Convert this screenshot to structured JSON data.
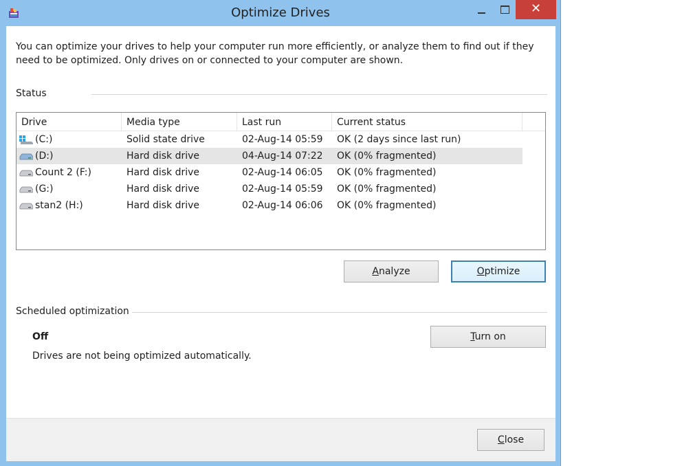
{
  "window": {
    "title": "Optimize Drives",
    "close_glyph": "✕"
  },
  "description": "You can optimize your drives to help your computer run more efficiently, or analyze them to find out if they need to be optimized. Only drives on or connected to your computer are shown.",
  "status_section": {
    "label": "Status",
    "columns": [
      "Drive",
      "Media type",
      "Last run",
      "Current status"
    ],
    "rows": [
      {
        "drive": "(C:)",
        "media": "Solid state drive",
        "last_run": "02-Aug-14 05:59",
        "status": "OK (2 days since last run)",
        "icon": "windows-drive-icon"
      },
      {
        "drive": "(D:)",
        "media": "Hard disk drive",
        "last_run": "04-Aug-14 07:22",
        "status": "OK (0% fragmented)",
        "icon": "hard-drive-icon",
        "selected": true
      },
      {
        "drive": "Count 2 (F:)",
        "media": "Hard disk drive",
        "last_run": "02-Aug-14 06:05",
        "status": "OK (0% fragmented)",
        "icon": "hard-drive-icon"
      },
      {
        "drive": "(G:)",
        "media": "Hard disk drive",
        "last_run": "02-Aug-14 05:59",
        "status": "OK (0% fragmented)",
        "icon": "hard-drive-icon"
      },
      {
        "drive": "stan2 (H:)",
        "media": "Hard disk drive",
        "last_run": "02-Aug-14 06:06",
        "status": "OK (0% fragmented)",
        "icon": "hard-drive-icon"
      }
    ],
    "analyze_button": {
      "pre": "",
      "accel": "A",
      "post": "nalyze"
    },
    "optimize_button": {
      "pre": "",
      "accel": "O",
      "post": "ptimize"
    }
  },
  "scheduled_section": {
    "label": "Scheduled optimization",
    "state": "Off",
    "description": "Drives are not being optimized automatically.",
    "turn_on_button": {
      "pre": "",
      "accel": "T",
      "post": "urn on"
    }
  },
  "close_button": {
    "pre": "",
    "accel": "C",
    "post": "lose"
  },
  "colors": {
    "frame": "#8fc2ec",
    "close_button": "#c7403a",
    "selected_row": "#e5e5e5",
    "default_button_border": "#3c7fb1"
  }
}
